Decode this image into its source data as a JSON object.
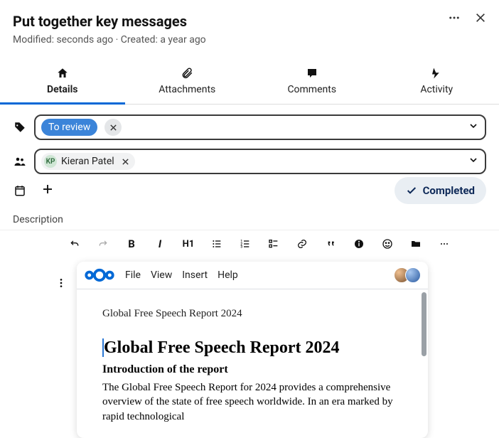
{
  "header": {
    "title": "Put together key messages",
    "meta": "Modified: seconds ago · Created: a year ago"
  },
  "tabs": {
    "details": "Details",
    "attachments": "Attachments",
    "comments": "Comments",
    "activity": "Activity"
  },
  "tags": {
    "chip1": "To review"
  },
  "people": {
    "initials": "KP",
    "name": "Kieran Patel"
  },
  "actions": {
    "completed": "Completed"
  },
  "description_label": "Description",
  "toolbar": {
    "bold": "B",
    "italic": "I",
    "h1": "H1"
  },
  "doc": {
    "menus": {
      "file": "File",
      "view": "View",
      "insert": "Insert",
      "help": "Help"
    },
    "path": "Global Free Speech Report 2024",
    "h1": "Global Free Speech Report 2024",
    "h2": "Introduction of the report",
    "p": "The Global Free Speech Report for 2024 provides a comprehensive overview of the state of free speech worldwide. In an era marked by rapid technological"
  }
}
